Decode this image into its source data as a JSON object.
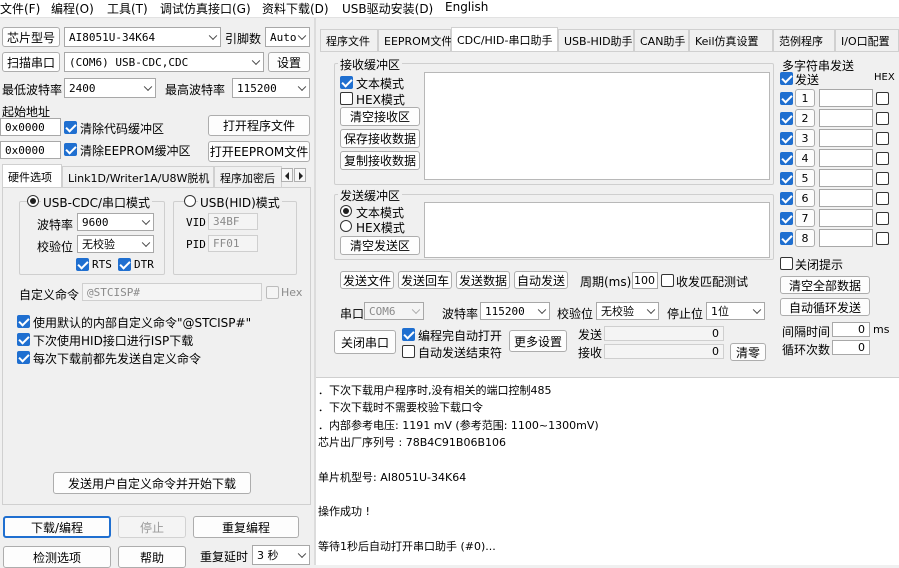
{
  "menu": [
    "文件(F)",
    "编程(O)",
    "工具(T)",
    "调试仿真接口(G)",
    "资料下载(D)",
    "USB驱动安装(D)",
    "English"
  ],
  "left": {
    "chip_label": "芯片型号",
    "chip_value": "AI8051U-34K64",
    "pin_label": "引脚数",
    "pin_value": "Auto",
    "scan_port": "扫描串口",
    "port_value": "(COM6) USB-CDC,CDC",
    "settings": "设置",
    "min_baud_label": "最低波特率",
    "min_baud_value": "2400",
    "max_baud_label": "最高波特率",
    "max_baud_value": "115200",
    "start_addr_label": "起始地址",
    "addr1": "0x0000",
    "clear_code_buf": "清除代码缓冲区",
    "open_program_file": "打开程序文件",
    "addr2": "0x0000",
    "clear_eeprom_buf": "清除EEPROM缓冲区",
    "open_eeprom_file": "打开EEPROM文件",
    "tabs": [
      "硬件选项",
      "Link1D/Writer1A/U8W脱机",
      "程序加密后"
    ],
    "usb_cdc_mode": "USB-CDC/串口模式",
    "baud_label": "波特率",
    "baud_value": "9600",
    "parity_label": "校验位",
    "parity_value": "无校验",
    "rts": "RTS",
    "dtr": "DTR",
    "usb_hid_mode": "USB(HID)模式",
    "vid_label": "VID",
    "vid_value": "34BF",
    "pid_label": "PID",
    "pid_value": "FF01",
    "custom_cmd_label": "自定义命令",
    "custom_cmd_value": "@STCISP#",
    "hex_label": "Hex",
    "opt1": "使用默认的内部自定义命令\"@STCISP#\"",
    "opt2": "下次使用HID接口进行ISP下载",
    "opt3": "每次下载前都先发送自定义命令",
    "send_custom_btn": "发送用户自定义命令并开始下载",
    "download_btn": "下载/编程",
    "stop_btn": "停止",
    "reprogram_btn": "重复编程",
    "detect_btn": "检测选项",
    "help_btn": "帮助",
    "repeat_delay_label": "重复延时",
    "repeat_delay_value": "3 秒"
  },
  "right_tabs": [
    "程序文件",
    "EEPROM文件",
    "CDC/HID-串口助手",
    "USB-HID助手",
    "CAN助手",
    "Keil仿真设置",
    "范例程序",
    "I/O口配置"
  ],
  "serial": {
    "recv_title": "接收缓冲区",
    "text_mode": "文本模式",
    "hex_mode": "HEX模式",
    "clear_recv": "清空接收区",
    "save_recv": "保存接收数据",
    "copy_recv": "复制接收数据",
    "send_title": "发送缓冲区",
    "send_text_mode": "文本模式",
    "send_hex_mode": "HEX模式",
    "clear_send": "清空发送区",
    "send_file": "发送文件",
    "send_enter": "发送回车",
    "send_data": "发送数据",
    "auto_send": "自动发送",
    "period_label": "周期(ms)",
    "period_value": "100",
    "match_test": "收发匹配测试",
    "port_label": "串口",
    "port_value": "COM6",
    "baud_label": "波特率",
    "baud_value": "115200",
    "parity_label": "校验位",
    "parity_value": "无校验",
    "stop_label": "停止位",
    "stop_value": "1位",
    "close_port": "关闭串口",
    "auto_open": "编程完自动打开",
    "auto_send_end": "自动发送结束符",
    "more_settings": "更多设置",
    "send_count_label": "发送",
    "send_count": "0",
    "recv_count_label": "接收",
    "recv_count": "0",
    "clear_zero": "清零",
    "multi_title": "多字符串发送",
    "send_col": "发送",
    "hex_col": "HEX",
    "rows": [
      "1",
      "2",
      "3",
      "4",
      "5",
      "6",
      "7",
      "8"
    ],
    "close_tip": "关闭提示",
    "clear_all": "清空全部数据",
    "auto_loop": "自动循环发送",
    "interval_label": "间隔时间",
    "interval_value": "0",
    "interval_unit": "ms",
    "loop_count_label": "循环次数",
    "loop_count_value": "0"
  },
  "log": [
    "．下次下载用户程序时,没有相关的端口控制485",
    "．下次下载时不需要校验下载口令",
    "．内部参考电压: 1191 mV (参考范围: 1100~1300mV)",
    "芯片出厂序列号 : 78B4C91B06B106",
    "",
    "  单片机型号: AI8051U-34K64",
    "",
    "操作成功 !",
    "",
    "等待1秒后自动打开串口助手 (#0)..."
  ],
  "colors": {
    "accent": "#1f6fd0"
  }
}
